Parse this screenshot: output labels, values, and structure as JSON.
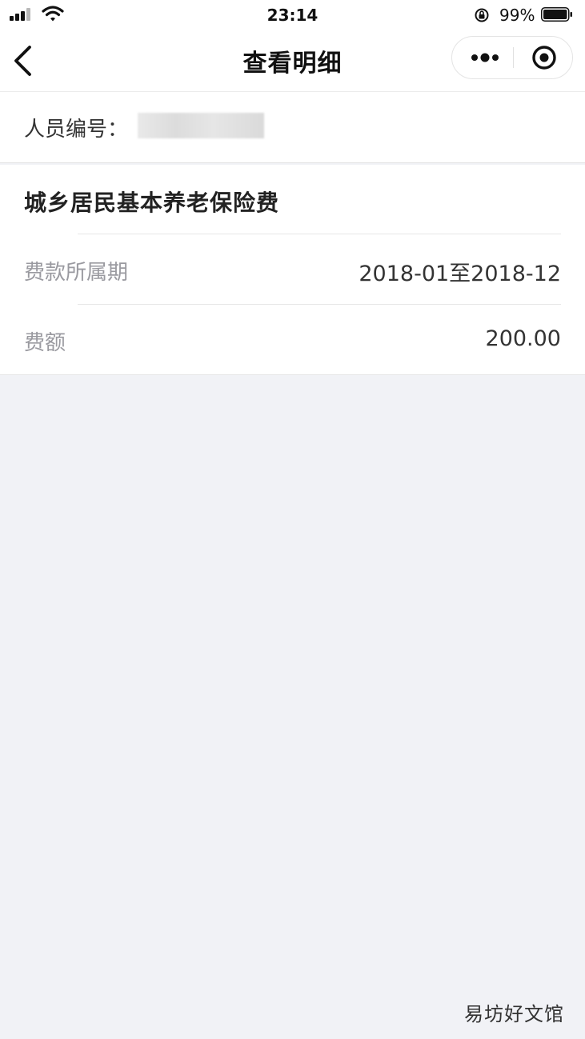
{
  "status_bar": {
    "time": "23:14",
    "battery_percent": "99%",
    "signal_bars": 3,
    "signal_total": 4
  },
  "nav": {
    "title": "查看明细",
    "back_icon": "chevron-left-icon",
    "more_icon": "more-dots-icon",
    "close_icon": "target-circle-icon"
  },
  "person": {
    "label": "人员编号：",
    "value": ""
  },
  "detail": {
    "title": "城乡居民基本养老保险费",
    "rows": [
      {
        "label": "费款所属期",
        "value": "2018-01至2018-12"
      },
      {
        "label": "费额",
        "value": "200.00"
      }
    ]
  },
  "watermark": "易坊好文馆",
  "colors": {
    "page_background": "#f1f2f6",
    "card_background": "#ffffff",
    "label_gray": "#9a9aa0",
    "text_dark": "#222222"
  }
}
